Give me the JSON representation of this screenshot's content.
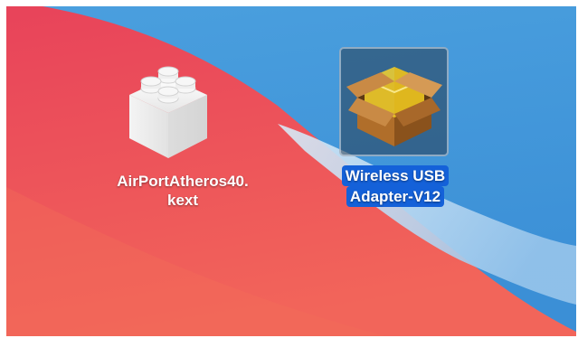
{
  "desktop": {
    "wallpaper": {
      "colors": {
        "red_top": "#e8435a",
        "red_bottom": "#f26a55",
        "blue_sky": "#4aa1df",
        "blue_light": "#b9dbf3"
      }
    },
    "icons": [
      {
        "name": "kext-file",
        "icon": "lego-brick-icon",
        "label_line1": "AirPortAtheros40.",
        "label_line2": "kext",
        "selected": false
      },
      {
        "name": "installer-package",
        "icon": "package-box-icon",
        "label_line1": "Wireless USB",
        "label_line2": "Adapter-V12",
        "selected": true,
        "selection_color": "#1461d9"
      }
    ]
  }
}
